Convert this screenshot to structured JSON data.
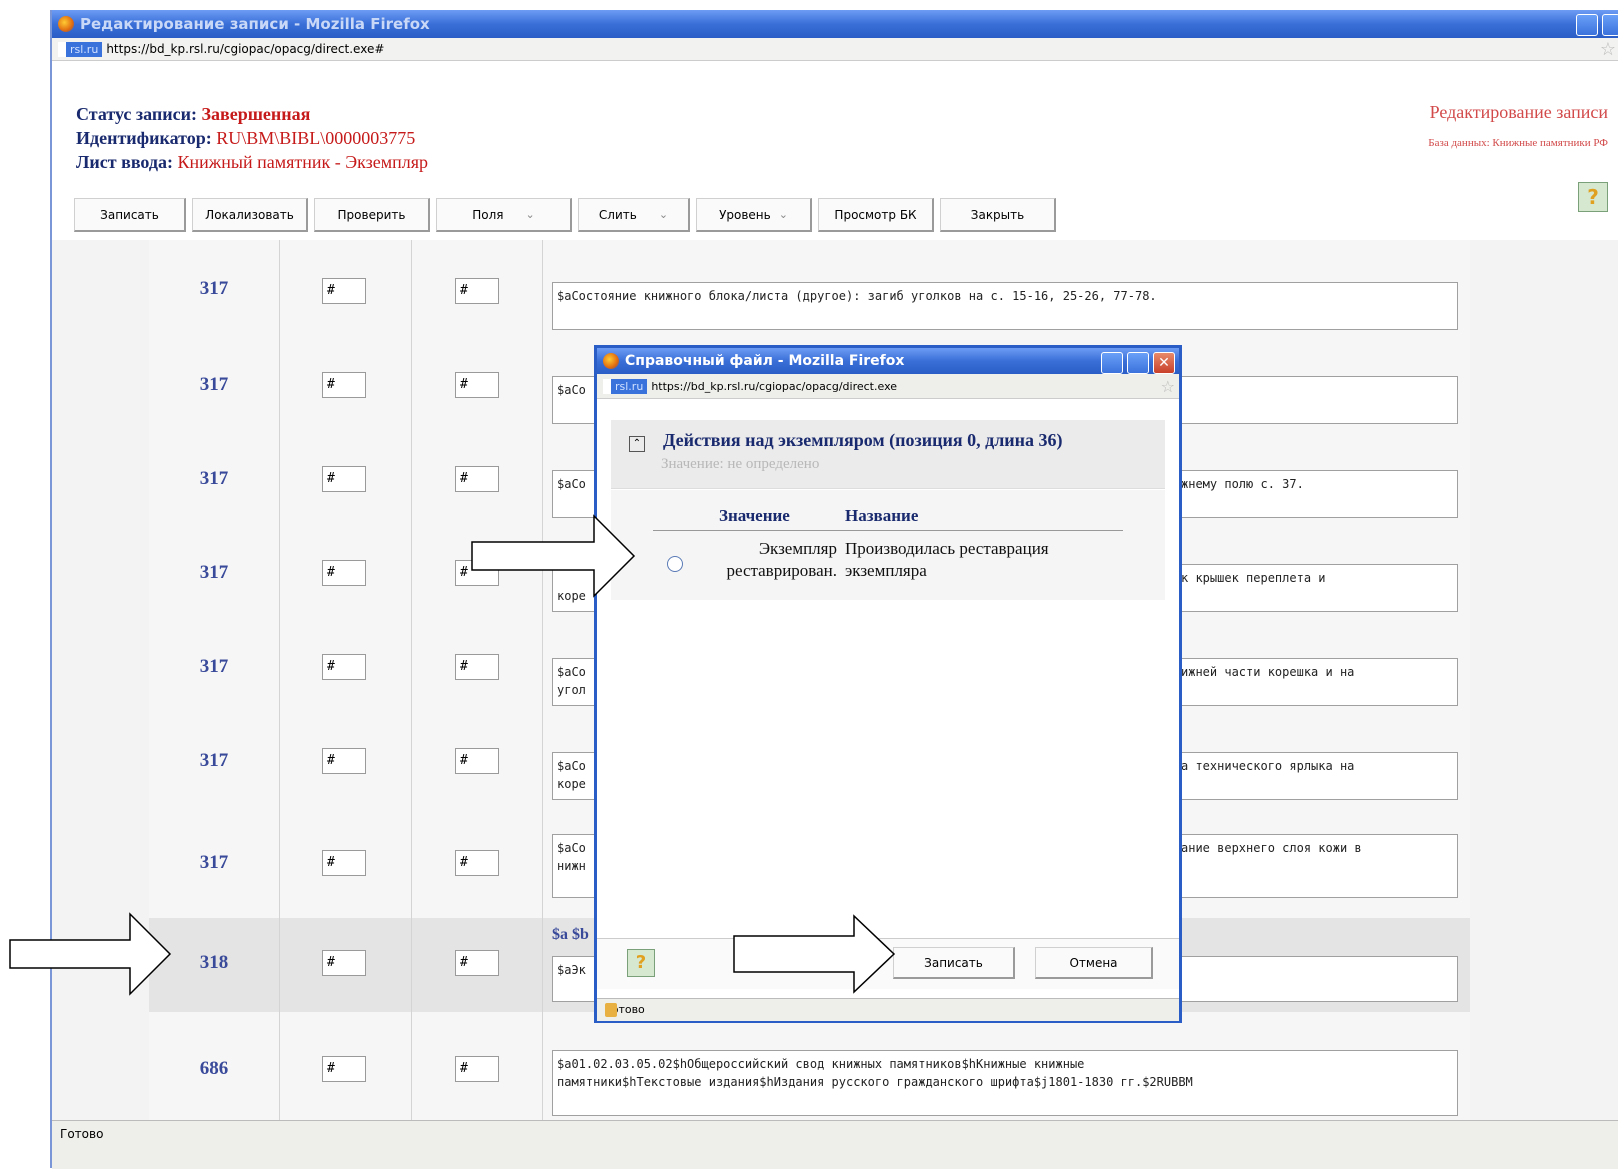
{
  "main_window": {
    "title": "Редактирование записи - Mozilla Firefox",
    "site_badge": "rsl.ru",
    "url": "https://bd_kp.rsl.ru/cgiopac/opacg/direct.exe#",
    "status": "Готово"
  },
  "header": {
    "status_label": "Статус записи:",
    "status_value": "Завершенная",
    "id_label": "Идентификатор:",
    "id_value": "RU\\BM\\BIBL\\0000003775",
    "sheet_label": "Лист ввода:",
    "sheet_value": "Книжный памятник - Экземпляр",
    "right_title": "Редактирование записи",
    "right_subtitle": "База данных: Книжные памятники РФ"
  },
  "toolbar": {
    "save": "Записать",
    "localize": "Локализовать",
    "check": "Проверить",
    "fields": "Поля",
    "merge": "Слить",
    "level": "Уровень",
    "preview": "Просмотр БК",
    "close": "Закрыть"
  },
  "rows": [
    {
      "tag": "317",
      "ind1": "#",
      "ind2": "#",
      "text": "$aСостояние книжного блока/листа (другое): загиб уголков на с. 15-16, 25-26, 77-78."
    },
    {
      "tag": "317",
      "ind1": "#",
      "ind2": "#",
      "text": "$aCo"
    },
    {
      "tag": "317",
      "ind1": "#",
      "ind2": "#",
      "text": "$aCo",
      "text_right": "жнему полю с. 37."
    },
    {
      "tag": "317",
      "ind1": "#",
      "ind2": "#",
      "text": "\nкоре",
      "text_right": "к крышек переплета и"
    },
    {
      "tag": "317",
      "ind1": "#",
      "ind2": "#",
      "text": "$aCo\nугол",
      "text_right": "ижней части корешка и на"
    },
    {
      "tag": "317",
      "ind1": "#",
      "ind2": "#",
      "text": "$aCo\nкоре",
      "text_right": "а технического ярлыка на"
    },
    {
      "tag": "317",
      "ind1": "#",
      "ind2": "#",
      "text": "$aCo\nнижн",
      "text_right": "ание верхнего слоя кожи в"
    },
    {
      "tag": "318",
      "ind1": "#",
      "ind2": "#",
      "sub": "$a $b",
      "text": "$aЭк"
    },
    {
      "tag": "686",
      "ind1": "#",
      "ind2": "#",
      "text": "$a01.02.03.05.02$hОбщероссийский свод книжных памятников$hКнижные книжные\nпамятники$hТекстовые издания$hИздания русского гражданского шрифта$j1801-1830 гг.$2RUBBM"
    }
  ],
  "popup": {
    "title": "Справочный файл - Mozilla Firefox",
    "site_badge": "rsl.ru",
    "url": "https://bd_kp.rsl.ru/cgiopac/opacg/direct.exe",
    "heading": "Действия над экземпляром (позиция 0, длина 36)",
    "subheading": "Значение: не определено",
    "col_value": "Значение",
    "col_name": "Название",
    "option_value": "Экземпляр реставрирован.",
    "option_name": "Производилась реставрация экземпляра",
    "save": "Записать",
    "cancel": "Отмена",
    "status": "Готово"
  }
}
